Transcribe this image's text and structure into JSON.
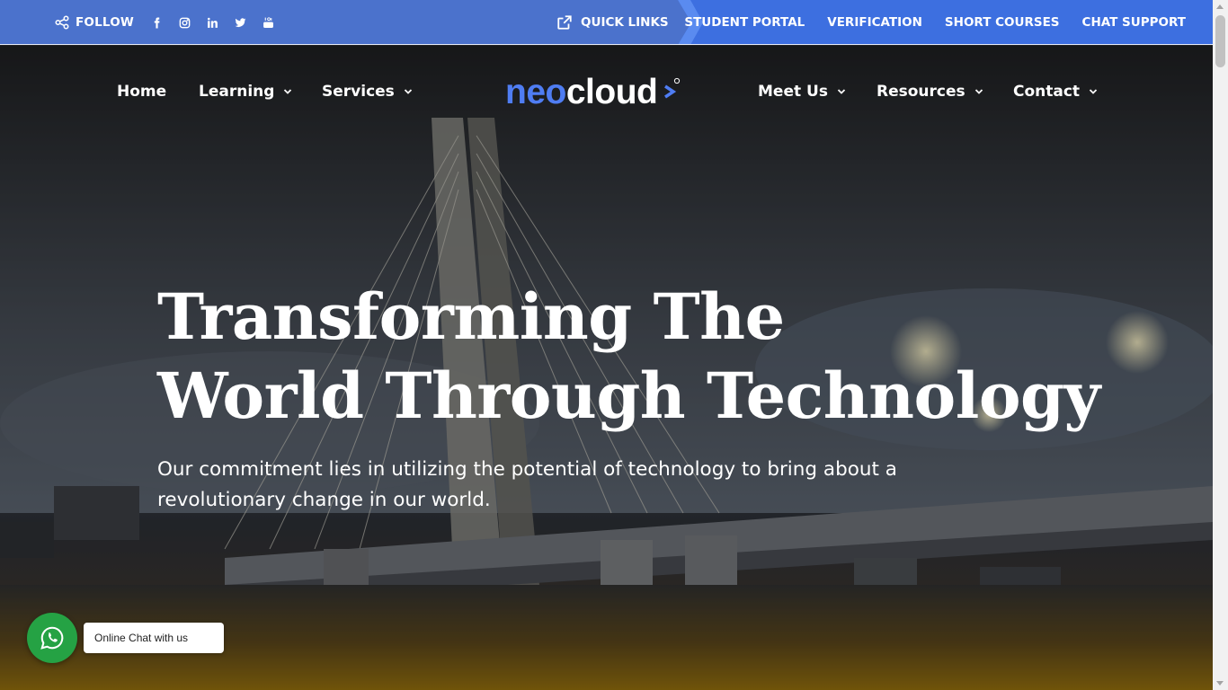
{
  "topbar": {
    "follow_label": "FOLLOW",
    "social_icons": [
      "facebook-icon",
      "instagram-icon",
      "linkedin-icon",
      "twitter-icon",
      "youtube-icon"
    ],
    "quick_links_label": "QUICK LINKS",
    "links": [
      {
        "label": "STUDENT PORTAL"
      },
      {
        "label": "VERIFICATION"
      },
      {
        "label": "SHORT COURSES"
      },
      {
        "label": "CHAT SUPPORT"
      }
    ]
  },
  "nav": {
    "left": [
      {
        "label": "Home",
        "has_dropdown": false
      },
      {
        "label": "Learning",
        "has_dropdown": true
      },
      {
        "label": "Services",
        "has_dropdown": true
      }
    ],
    "right": [
      {
        "label": "Meet Us",
        "has_dropdown": true
      },
      {
        "label": "Resources",
        "has_dropdown": true
      },
      {
        "label": "Contact",
        "has_dropdown": true
      }
    ]
  },
  "logo": {
    "part1": "neo",
    "part2": "cloud"
  },
  "hero": {
    "headline_line1": "Transforming The",
    "headline_line2": "World Through Technology",
    "subline": "Our commitment lies in utilizing the potential of technology to bring about a revolutionary change in our world."
  },
  "chat_widget": {
    "label": "Online Chat with us"
  },
  "colors": {
    "topbar": "#4b72cc",
    "topbar_accent": "#3d6fe0",
    "brand_blue": "#4f7df3",
    "whatsapp_green": "#25a244"
  }
}
